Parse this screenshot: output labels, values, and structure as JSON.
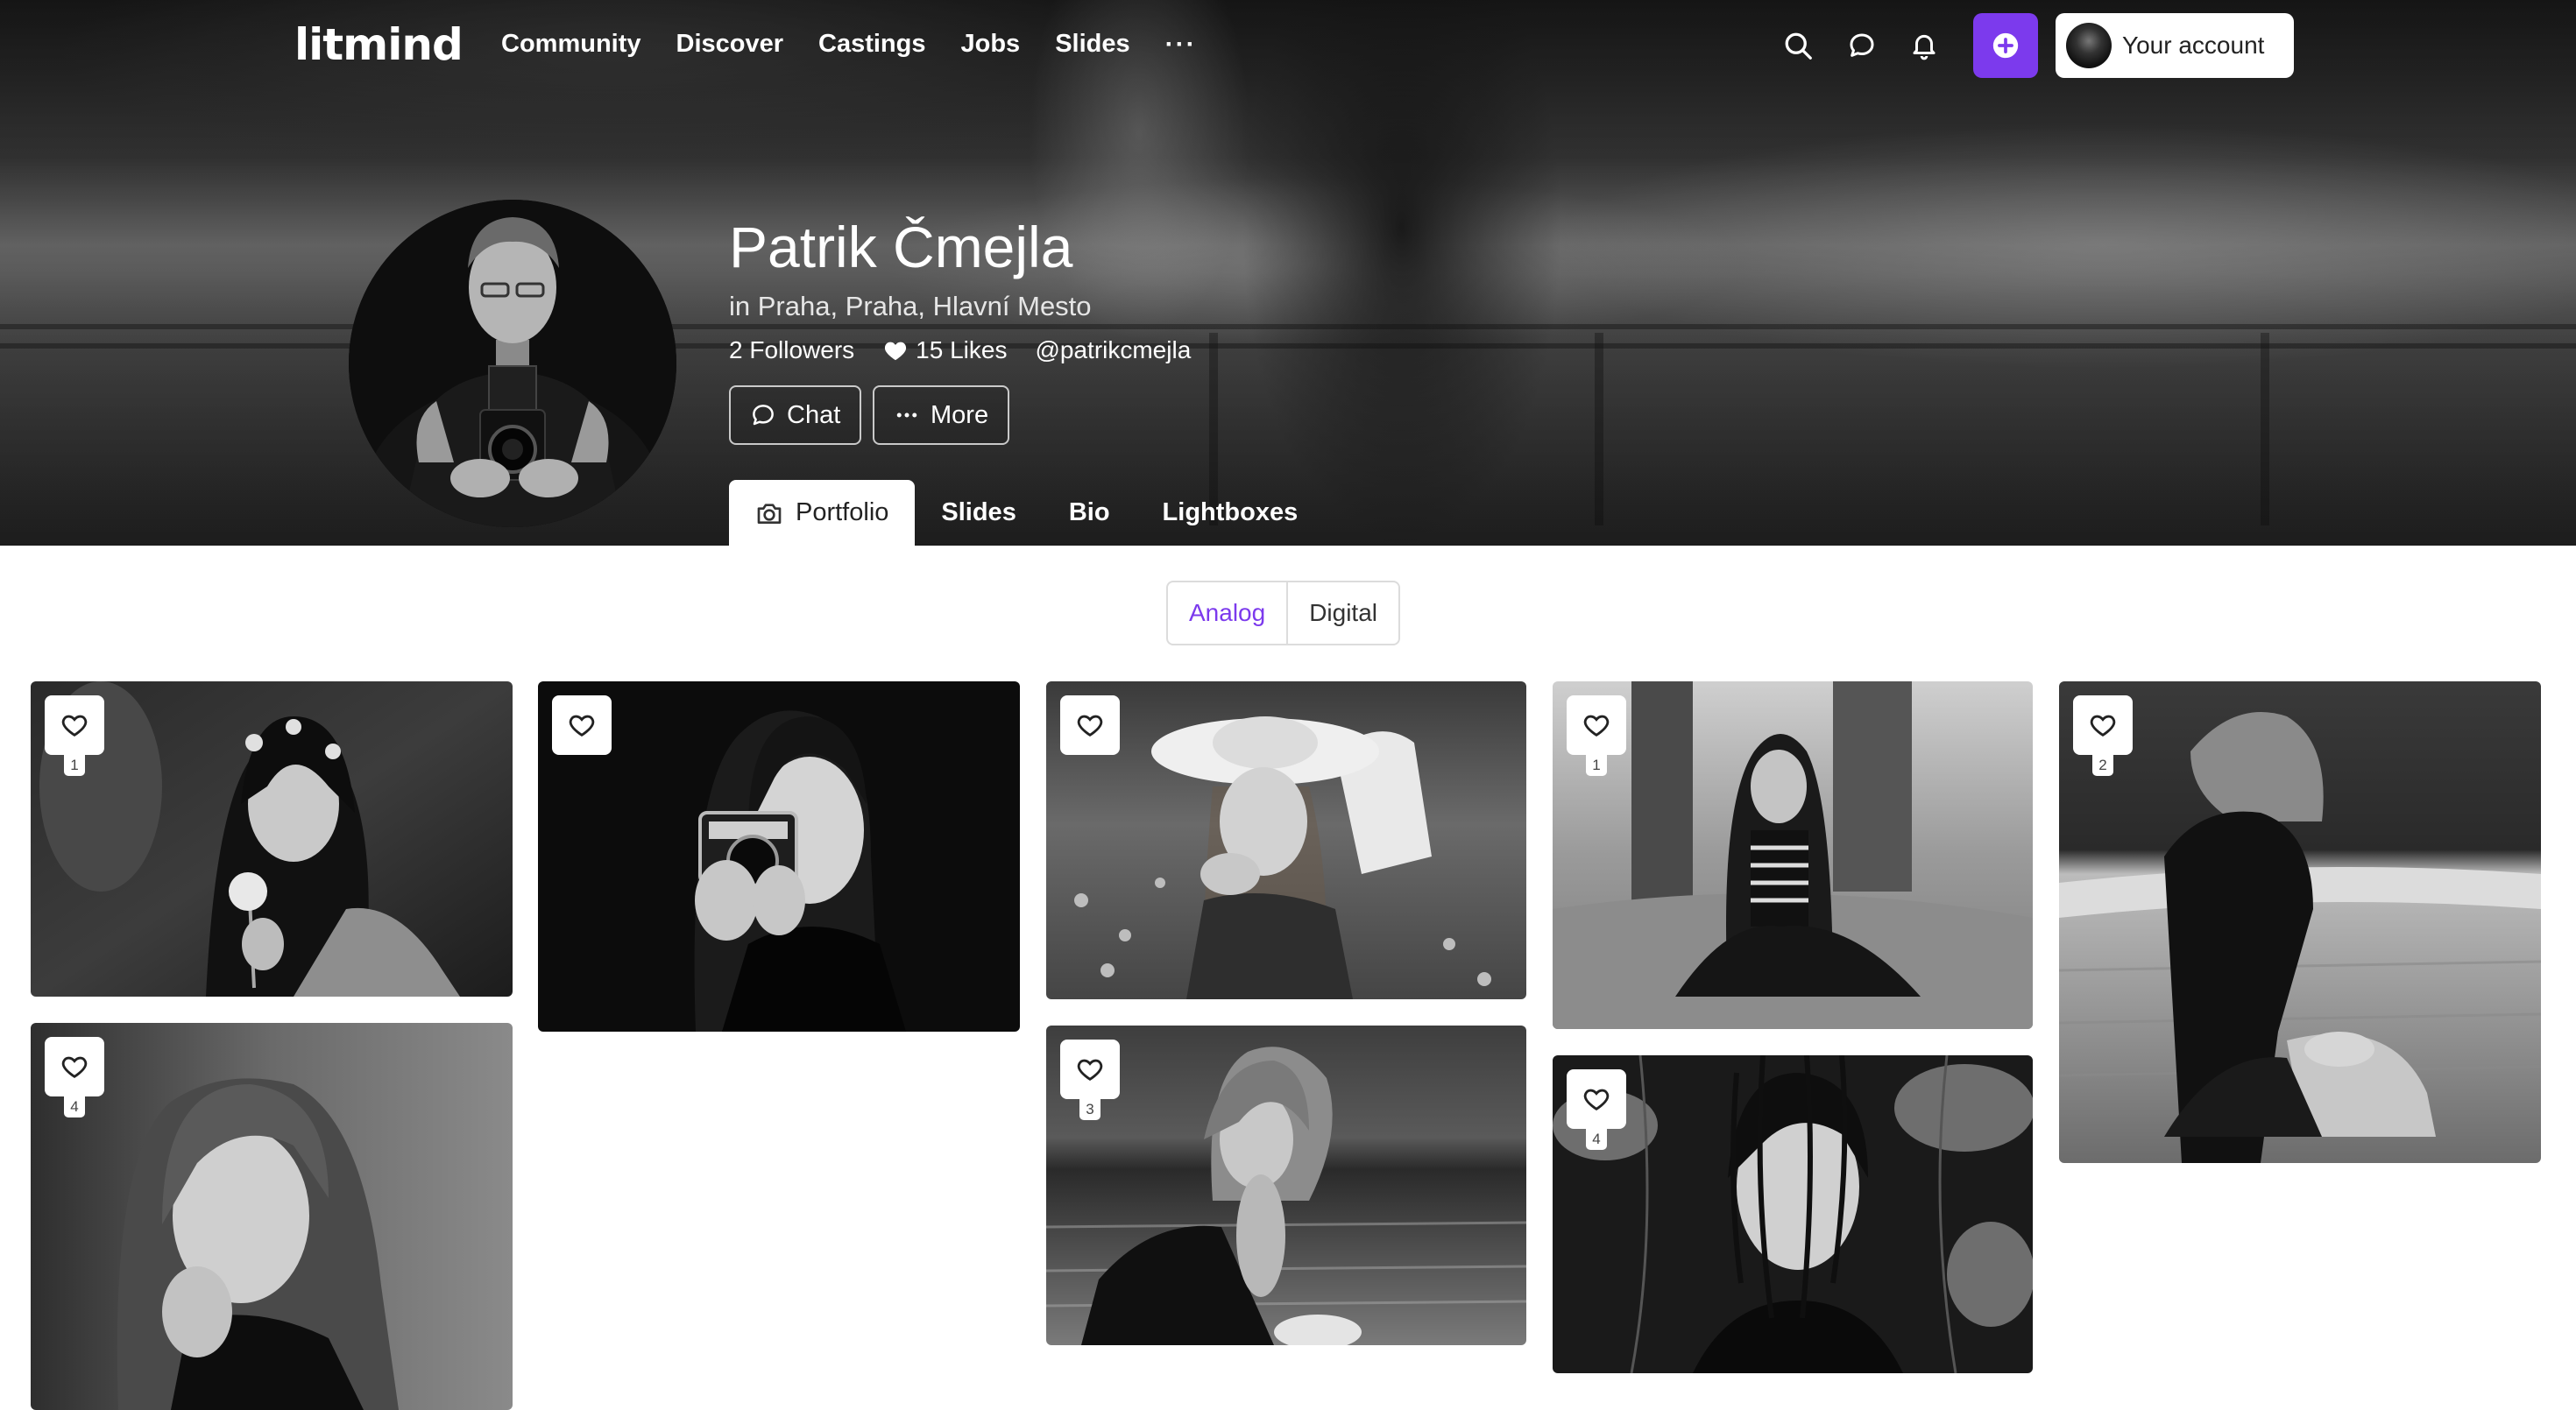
{
  "nav": {
    "logo": "litmind",
    "links": [
      "Community",
      "Discover",
      "Castings",
      "Jobs",
      "Slides"
    ],
    "more_label": "···",
    "icons": [
      "search-icon",
      "chat-icon",
      "bell-icon",
      "plus-icon"
    ],
    "account_label": "Your account",
    "accent_color": "#7c3aed"
  },
  "profile": {
    "name": "Patrik Čmejla",
    "location": "in Praha, Praha, Hlavní Mesto",
    "followers": "2 Followers",
    "likes": "15 Likes",
    "handle": "@patrikcmejla",
    "chat_label": "Chat",
    "more_label": "More"
  },
  "tabs": [
    {
      "label": "Portfolio",
      "active": true
    },
    {
      "label": "Slides",
      "active": false
    },
    {
      "label": "Bio",
      "active": false
    },
    {
      "label": "Lightboxes",
      "active": false
    }
  ],
  "filter": {
    "options": [
      "Analog",
      "Digital"
    ],
    "selected": "Analog"
  },
  "photos": [
    {
      "favorites": "1",
      "scene": "Woman with flowers in hair holding a flower"
    },
    {
      "favorites": "",
      "scene": "Woman holding a film camera to her eye"
    },
    {
      "favorites": "",
      "scene": "Woman in sun hat lying among flowers"
    },
    {
      "favorites": "1",
      "scene": "Woman sitting on grass under a tree"
    },
    {
      "favorites": "2",
      "scene": "Woman sitting at the edge of a fountain"
    },
    {
      "favorites": "4",
      "scene": "Woman resting head on hand"
    },
    {
      "favorites": "3",
      "scene": "Woman by the water with windblown hair"
    },
    {
      "favorites": "4",
      "scene": "Woman under tree branches with shadows"
    }
  ]
}
